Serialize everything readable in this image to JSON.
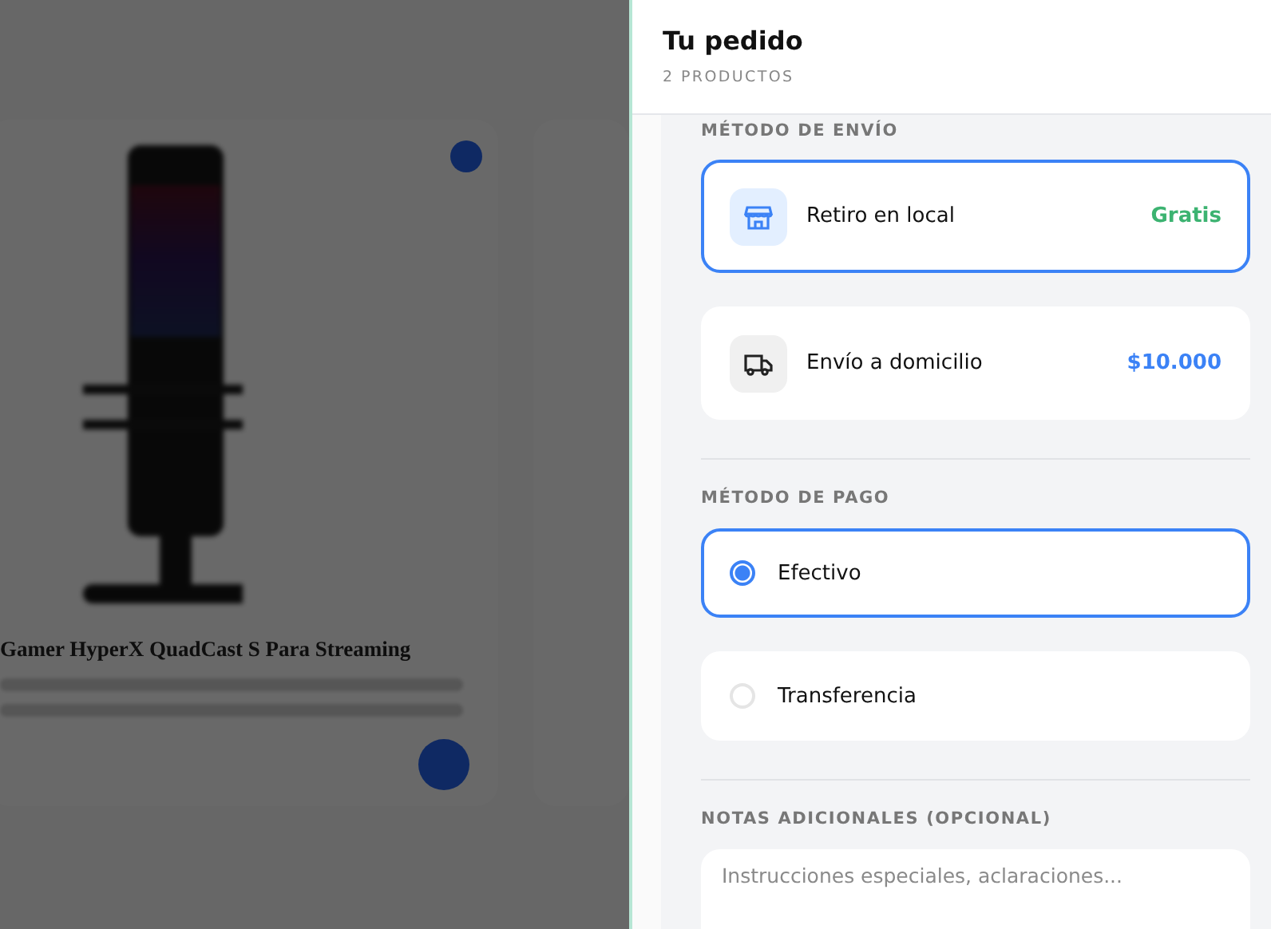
{
  "background": {
    "product_title": "Gamer HyperX QuadCast S Para Streaming"
  },
  "drawer": {
    "title": "Tu pedido",
    "subtitle": "2 PRODUCTOS"
  },
  "shipping": {
    "heading": "MÉTODO DE ENVÍO",
    "options": [
      {
        "kind": "store",
        "label": "Retiro en local",
        "price": "Gratis",
        "color": "#3cb371",
        "selected": true
      },
      {
        "kind": "truck",
        "label": "Envío a domicilio",
        "price": "$10.000",
        "color": "#3b82f6",
        "selected": false
      }
    ]
  },
  "payment": {
    "heading": "MÉTODO DE PAGO",
    "options": [
      {
        "label": "Efectivo",
        "selected": true
      },
      {
        "label": "Transferencia",
        "selected": false
      }
    ]
  },
  "notes": {
    "heading": "NOTAS ADICIONALES (OPCIONAL)",
    "placeholder": "Instrucciones especiales, aclaraciones..."
  }
}
